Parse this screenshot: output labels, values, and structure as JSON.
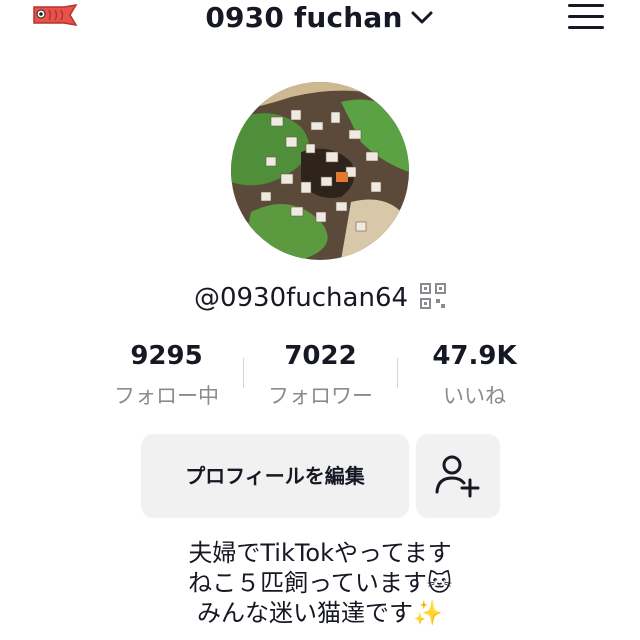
{
  "header": {
    "title": "0930 fuchan",
    "left_icon": "koinobori-icon",
    "title_icon": "chevron-down-icon",
    "menu_icon": "hamburger-menu-icon"
  },
  "profile": {
    "avatar_icon": "profile-photo",
    "handle": "@0930fuchan64",
    "qr_icon": "qr-code-icon"
  },
  "stats": [
    {
      "value": "9295",
      "label": "フォロー中"
    },
    {
      "value": "7022",
      "label": "フォロワー"
    },
    {
      "value": "47.9K",
      "label": "いいね"
    }
  ],
  "actions": {
    "edit_profile": "プロフィールを編集",
    "add_friend_icon": "add-user-icon"
  },
  "bio": [
    "夫婦でTikTokやってます",
    "ねこ５匹飼っています🐱",
    "みんな迷い猫達です✨"
  ],
  "colors": {
    "text": "#161823",
    "secondary_text": "#8a8b91",
    "button_bg": "#f1f1f2",
    "koi_red": "#e5534b"
  }
}
